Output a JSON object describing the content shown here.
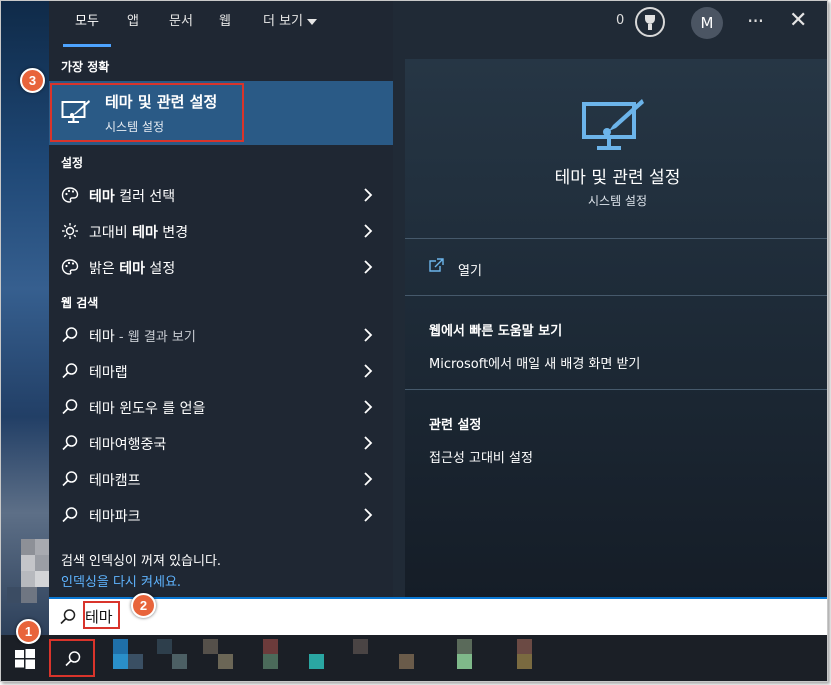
{
  "tabs": [
    {
      "label": "모두",
      "active": true
    },
    {
      "label": "앱",
      "active": false
    },
    {
      "label": "문서",
      "active": false
    },
    {
      "label": "웹",
      "active": false
    },
    {
      "label": "더 보기",
      "active": false
    }
  ],
  "header": {
    "points": "0",
    "avatar_initial": "M",
    "more_glyph": "···",
    "close_glyph": "✕"
  },
  "best_match": {
    "heading": "가장 정확",
    "title": "테마 및 관련 설정",
    "subtitle": "시스템 설정"
  },
  "settings": {
    "heading": "설정",
    "items": [
      {
        "bold": "테마",
        "rest": " 컬러 선택",
        "icon": "palette-icon"
      },
      {
        "pre": "고대비 ",
        "bold": "테마",
        "rest": " 변경",
        "icon": "sun-icon"
      },
      {
        "pre": "밝은 ",
        "bold": "테마",
        "rest": " 설정",
        "icon": "palette-icon"
      }
    ]
  },
  "web_search": {
    "heading": "웹 검색",
    "items": [
      {
        "label": "테마",
        "suffix": " - 웹 결과 보기"
      },
      {
        "label": "테마랩"
      },
      {
        "label": "테마 윈도우 를 얻을"
      },
      {
        "label": "테마여행중국"
      },
      {
        "label": "테마캠프"
      },
      {
        "label": "테마파크"
      }
    ]
  },
  "index_notice": {
    "text": "검색 인덱싱이 꺼져 있습니다.",
    "link": "인덱싱을 다시 켜세요."
  },
  "preview": {
    "title": "테마 및 관련 설정",
    "subtitle": "시스템 설정",
    "open_label": "열기",
    "web_help_heading": "웹에서 빠른 도움말 보기",
    "web_help_link": "Microsoft에서 매일 새 배경 화면 받기",
    "related_heading": "관련 설정",
    "related_link": "접근성 고대비 설정"
  },
  "search": {
    "value": "테마"
  },
  "badges": {
    "step1": "1",
    "step2": "2",
    "step3": "3"
  },
  "colors": {
    "accent": "#0a78d4",
    "highlight_outline": "#d9342b",
    "badge": "#e8643b",
    "selected_row": "#2a5a86",
    "link": "#5fb4ff"
  }
}
